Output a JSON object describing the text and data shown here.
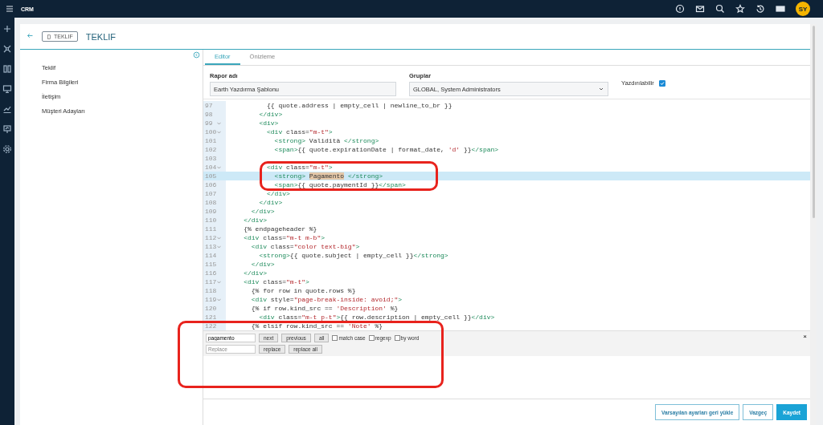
{
  "app": {
    "logo": "CRM",
    "avatar": "SY"
  },
  "header": {
    "badge": "TEKLIF",
    "title": "TEKLIF"
  },
  "sections": [
    {
      "label": "Teklif"
    },
    {
      "label": "Firma Bilgileri"
    },
    {
      "label": "İletişim"
    },
    {
      "label": "Müşteri Adayları"
    }
  ],
  "tabs": [
    {
      "label": "Editor",
      "selected": true
    },
    {
      "label": "Önizleme",
      "selected": false
    }
  ],
  "form": {
    "name_label": "Rapor adı",
    "name_value": "Earth Yazdırma Şablonu",
    "groups_label": "Gruplar",
    "groups_value": "GLOBAL, System Administrators",
    "printable_label": "Yazdırılabilir",
    "printable_checked": true
  },
  "code_lines": [
    {
      "number": "97",
      "foldable": false,
      "active": false,
      "text": "          {{ quote.address | empty_cell | newline_to_br }}"
    },
    {
      "number": "98",
      "foldable": false,
      "active": false,
      "text": "        </div>"
    },
    {
      "number": "99",
      "foldable": true,
      "active": false,
      "text": "        <div>"
    },
    {
      "number": "100",
      "foldable": true,
      "active": false,
      "text": "          <div class=\"m-t\">"
    },
    {
      "number": "101",
      "foldable": false,
      "active": false,
      "text": "            <strong> Validità </strong>"
    },
    {
      "number": "102",
      "foldable": false,
      "active": false,
      "text": "            <span>{{ quote.expirationDate | format_date, 'd' }}</span>"
    },
    {
      "number": "103",
      "foldable": false,
      "active": false
    },
    {
      "number": "104",
      "foldable": true,
      "active": false,
      "text": "          <div class=\"m-t\">"
    },
    {
      "number": "105",
      "foldable": false,
      "active": true,
      "parts": [
        {
          "text": "            <strong> "
        },
        {
          "text": "Pagamento",
          "match": true
        },
        {
          "text": " </strong>"
        }
      ]
    },
    {
      "number": "106",
      "foldable": false,
      "active": false,
      "text": "            <span>{{ quote.paymentId }}</span>"
    },
    {
      "number": "107",
      "foldable": false,
      "active": false,
      "text": "          </div>"
    },
    {
      "number": "108",
      "foldable": false,
      "active": false,
      "text": "        </div>"
    },
    {
      "number": "109",
      "foldable": false,
      "active": false,
      "text": "      </div>"
    },
    {
      "number": "110",
      "foldable": false,
      "active": false,
      "text": "    </div>"
    },
    {
      "number": "111",
      "foldable": false,
      "active": false,
      "text": "    {% endpageheader %}"
    },
    {
      "number": "112",
      "foldable": true,
      "active": false,
      "text": "    <div class=\"m-t m-b\">"
    },
    {
      "number": "113",
      "foldable": true,
      "active": false,
      "text": "      <div class=\"color text-big\">"
    },
    {
      "number": "114",
      "foldable": false,
      "active": false,
      "text": "        <strong>{{ quote.subject | empty_cell }}</strong>"
    },
    {
      "number": "115",
      "foldable": false,
      "active": false,
      "text": "      </div>"
    },
    {
      "number": "116",
      "foldable": false,
      "active": false,
      "text": "    </div>"
    },
    {
      "number": "117",
      "foldable": true,
      "active": false,
      "text": "    <div class=\"m-t\">"
    },
    {
      "number": "118",
      "foldable": false,
      "active": false,
      "text": "      {% for row in quote.rows %}"
    },
    {
      "number": "119",
      "foldable": true,
      "active": false,
      "text": "      <div style=\"page-break-inside: avoid;\">"
    },
    {
      "number": "120",
      "foldable": false,
      "active": false,
      "text": "      {% if row.kind_src == 'Description' %}"
    },
    {
      "number": "121",
      "foldable": false,
      "active": false,
      "text": "        <div class=\"m-t p-t\">{{ row.description | empty_cell }}</div>"
    },
    {
      "number": "122",
      "foldable": false,
      "active": false,
      "text": "      {% elsif row.kind_src == 'Note' %}"
    }
  ],
  "find_bar": {
    "search_value": "pagamento",
    "replace_placeholder": "Replace",
    "buttons": [
      "next",
      "previous",
      "all"
    ],
    "options": [
      {
        "label": "match case",
        "checked": false
      },
      {
        "label": "regexp",
        "checked": false
      },
      {
        "label": "by word",
        "checked": false
      }
    ],
    "replace_buttons": [
      "replace",
      "replace all"
    ],
    "close": "×"
  },
  "footer": {
    "buttons": [
      {
        "label": "Varsayılan ayarları geri yükle",
        "kind": "outline"
      },
      {
        "label": "Vazgeç",
        "kind": "outline"
      },
      {
        "label": "Kaydet",
        "kind": "primary"
      }
    ]
  }
}
